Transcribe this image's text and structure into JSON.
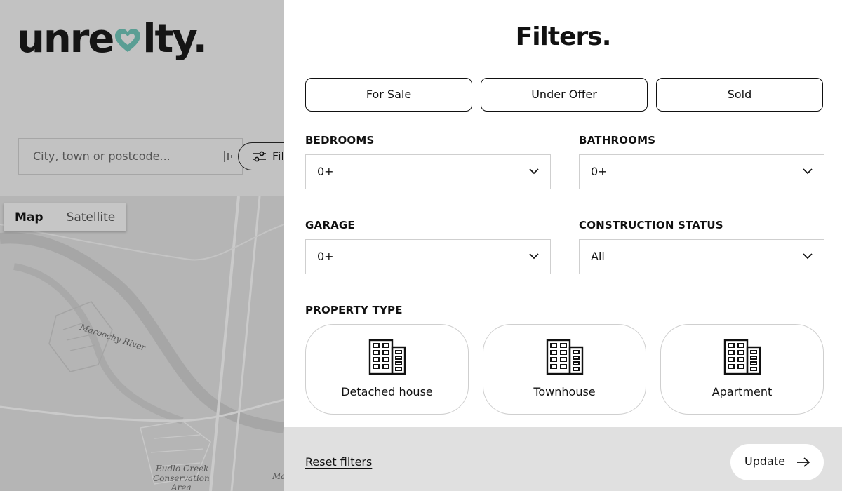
{
  "brand": {
    "logo_prefix": "unre",
    "logo_suffix": "lty.",
    "heart_color": "#5a9e94"
  },
  "search": {
    "placeholder": "City, town or postcode...",
    "filters_button_label": "Filters"
  },
  "map": {
    "toggle": [
      "Map",
      "Satellite"
    ],
    "active_toggle": "Map",
    "labels": [
      "Maroochy River",
      "Eudlo Creek",
      "Conservation",
      "Area",
      "Ma"
    ]
  },
  "filters": {
    "title": "Filters.",
    "status_buttons": [
      "For Sale",
      "Under Offer",
      "Sold"
    ],
    "bedrooms": {
      "label": "BEDROOMS",
      "value": "0+"
    },
    "bathrooms": {
      "label": "BATHROOMS",
      "value": "0+"
    },
    "garage": {
      "label": "GARAGE",
      "value": "0+"
    },
    "construction_status": {
      "label": "CONSTRUCTION STATUS",
      "value": "All"
    },
    "property_type": {
      "label": "PROPERTY TYPE",
      "options": [
        "Detached house",
        "Townhouse",
        "Apartment"
      ],
      "icon": "building-icon"
    },
    "reset_label": "Reset filters",
    "update_label": "Update"
  }
}
